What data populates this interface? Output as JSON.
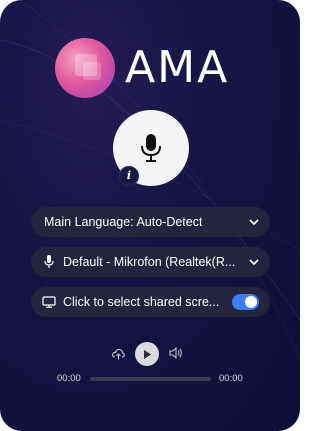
{
  "brand": {
    "logo_text": "AMA"
  },
  "mic": {
    "icon": "microphone-icon",
    "info_icon_label": "i"
  },
  "language": {
    "label": "Main Language: Auto-Detect"
  },
  "microphone_select": {
    "label": "Default - Mikrofon (Realtek(R..."
  },
  "screen_share": {
    "label": "Click to select shared scre...",
    "enabled": true
  },
  "player": {
    "current_time": "00:00",
    "duration": "00:00",
    "progress": 0
  },
  "colors": {
    "accent": "#3d7ef5",
    "background": "#151343",
    "row": "#24243f"
  }
}
